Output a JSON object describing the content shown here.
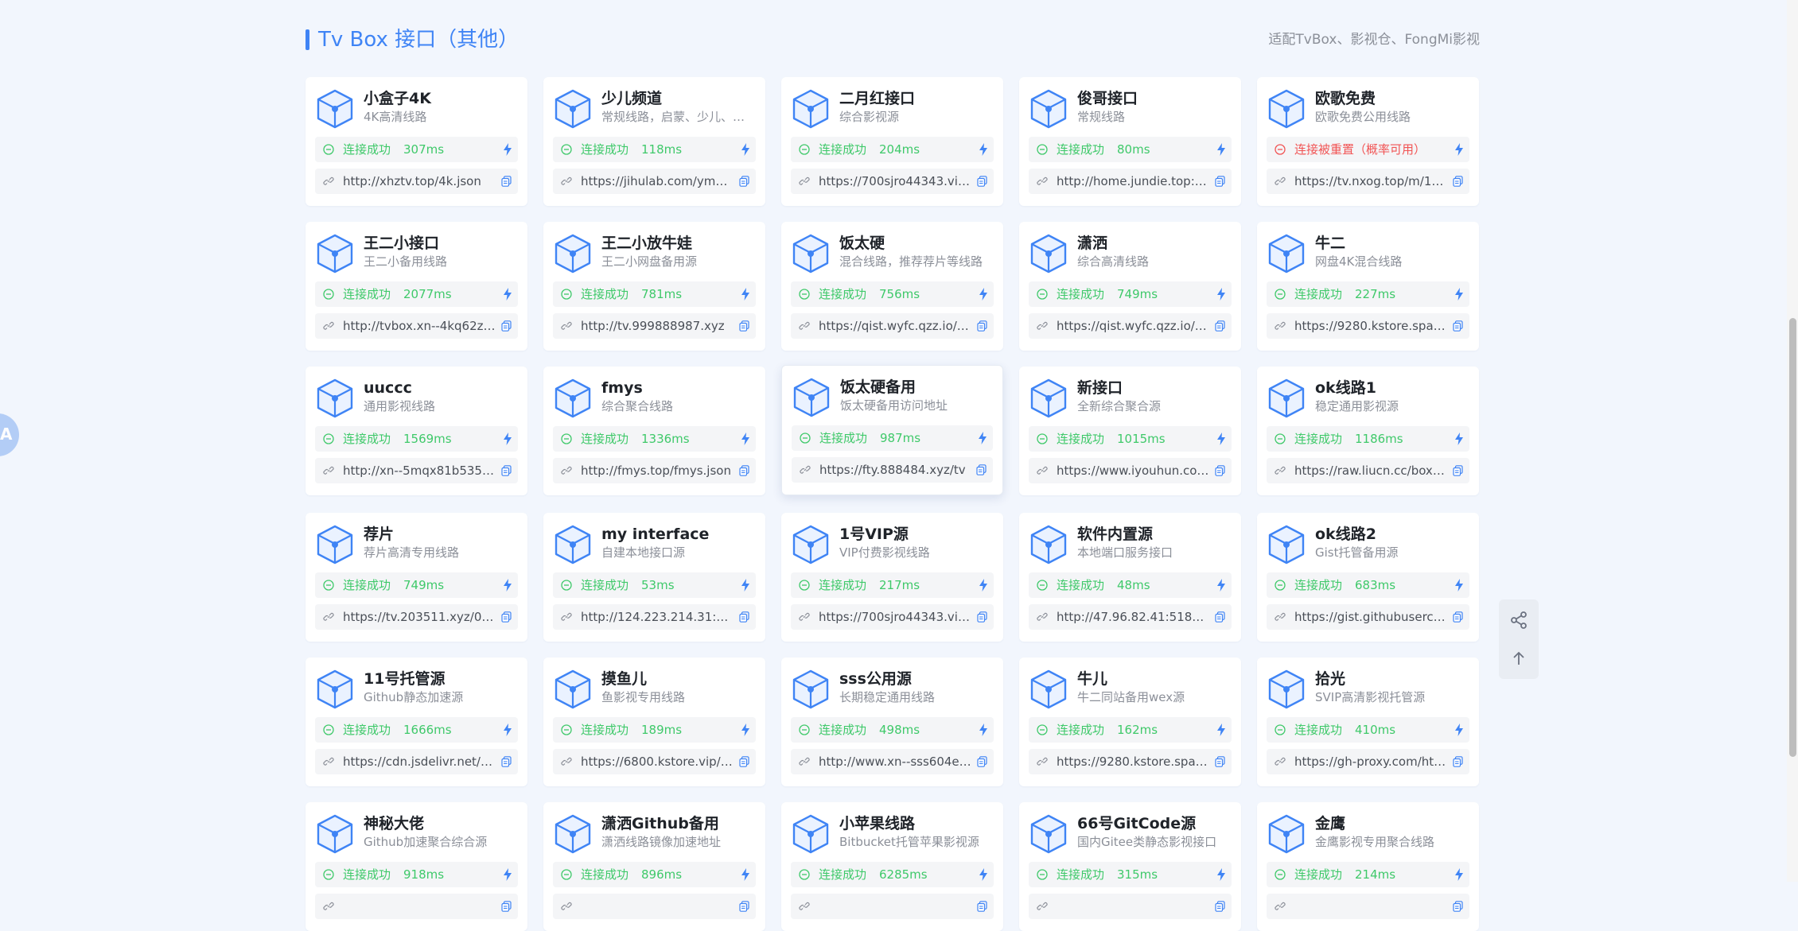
{
  "section": {
    "title": "Tv Box 接口（其他）",
    "subtitle": "适配TvBox、影视仓、FongMi影视"
  },
  "icons": {
    "logo": "cube-icon",
    "status": "signal-icon",
    "speed": "bolt-icon",
    "link": "link-icon",
    "copy": "copy-icon",
    "share": "share-icon",
    "top": "arrow-up-icon",
    "translate": "translate-icon"
  },
  "colors": {
    "accent": "#3f84f5",
    "success": "#3fc96a",
    "error": "#f15454"
  },
  "translate_label": "A",
  "cards": [
    {
      "name": "小盒子4K",
      "desc": "4K高清线路",
      "status": "连接成功",
      "latency": "307ms",
      "ok": true,
      "url": "http://xhztv.top/4k.json"
    },
    {
      "name": "少儿频道",
      "desc": "常规线路，启蒙、少儿、…",
      "status": "连接成功",
      "latency": "118ms",
      "ok": true,
      "url": "https://jihulab.com/ymz1…"
    },
    {
      "name": "二月红接口",
      "desc": "综合影视源",
      "status": "连接成功",
      "latency": "204ms",
      "ok": true,
      "url": "https://700sjro44343.vic…"
    },
    {
      "name": "俊哥接口",
      "desc": "常规线路",
      "status": "连接成功",
      "latency": "80ms",
      "ok": true,
      "url": "http://home.jundie.top:8…"
    },
    {
      "name": "欧歌免费",
      "desc": "欧歌免费公用线路",
      "status": "连接被重置（概率可用）",
      "latency": "",
      "ok": false,
      "url": "https://tv.nxog.top/m/11…"
    },
    {
      "name": "王二小接口",
      "desc": "王二小备用线路",
      "status": "连接成功",
      "latency": "2077ms",
      "ok": true,
      "url": "http://tvbox.xn--4kq62z…"
    },
    {
      "name": "王二小放牛娃",
      "desc": "王二小网盘备用源",
      "status": "连接成功",
      "latency": "781ms",
      "ok": true,
      "url": "http://tv.999888987.xyz"
    },
    {
      "name": "饭太硬",
      "desc": "混合线路，推荐荐片等线路",
      "status": "连接成功",
      "latency": "756ms",
      "ok": true,
      "url": "https://qist.wyfc.qzz.io/ft…"
    },
    {
      "name": "潇洒",
      "desc": "综合高清线路",
      "status": "连接成功",
      "latency": "749ms",
      "ok": true,
      "url": "https://qist.wyfc.qzz.io/x…"
    },
    {
      "name": "牛二",
      "desc": "网盘4K混合线路",
      "status": "连接成功",
      "latency": "227ms",
      "ok": true,
      "url": "https://9280.kstore.spac…"
    },
    {
      "name": "uuccc",
      "desc": "通用影视线路",
      "status": "连接成功",
      "latency": "1569ms",
      "ok": true,
      "url": "http://xn--5mqx81b535…"
    },
    {
      "name": "fmys",
      "desc": "综合聚合线路",
      "status": "连接成功",
      "latency": "1336ms",
      "ok": true,
      "url": "http://fmys.top/fmys.json"
    },
    {
      "name": "饭太硬备用",
      "desc": "饭太硬备用访问地址",
      "status": "连接成功",
      "latency": "987ms",
      "ok": true,
      "url": "https://fty.888484.xyz/tv",
      "hovered": true
    },
    {
      "name": "新接口",
      "desc": "全新综合聚合源",
      "status": "连接成功",
      "latency": "1015ms",
      "ok": true,
      "url": "https://www.iyouhun.co…"
    },
    {
      "name": "ok线路1",
      "desc": "稳定通用影视源",
      "status": "连接成功",
      "latency": "1186ms",
      "ok": true,
      "url": "https://raw.liucn.cc/box/…"
    },
    {
      "name": "荐片",
      "desc": "荐片高清专用线路",
      "status": "连接成功",
      "latency": "749ms",
      "ok": true,
      "url": "https://tv.203511.xyz/08…"
    },
    {
      "name": "my interface",
      "desc": "自建本地接口源",
      "status": "连接成功",
      "latency": "53ms",
      "ok": true,
      "url": "http://124.223.214.31:8/…"
    },
    {
      "name": "1号VIP源",
      "desc": "VIP付费影视线路",
      "status": "连接成功",
      "latency": "217ms",
      "ok": true,
      "url": "https://700sjro44343.vic…"
    },
    {
      "name": "软件内置源",
      "desc": "本地端口服务接口",
      "status": "连接成功",
      "latency": "48ms",
      "ok": true,
      "url": "http://47.96.82.41:5188/…"
    },
    {
      "name": "ok线路2",
      "desc": "Gist托管备用源",
      "status": "连接成功",
      "latency": "683ms",
      "ok": true,
      "url": "https://gist.githubuserco…"
    },
    {
      "name": "11号托管源",
      "desc": "Github静态加速源",
      "status": "连接成功",
      "latency": "1666ms",
      "ok": true,
      "url": "https://cdn.jsdelivr.net/g…"
    },
    {
      "name": "摸鱼儿",
      "desc": "鱼影视专用线路",
      "status": "连接成功",
      "latency": "189ms",
      "ok": true,
      "url": "https://6800.kstore.vip/fi…"
    },
    {
      "name": "sss公用源",
      "desc": "长期稳定通用线路",
      "status": "连接成功",
      "latency": "498ms",
      "ok": true,
      "url": "http://www.xn--sss604e…"
    },
    {
      "name": "牛儿",
      "desc": "牛二同站备用wex源",
      "status": "连接成功",
      "latency": "162ms",
      "ok": true,
      "url": "https://9280.kstore.spac…"
    },
    {
      "name": "拾光",
      "desc": "SVIP高清影视托管源",
      "status": "连接成功",
      "latency": "410ms",
      "ok": true,
      "url": "https://gh-proxy.com/htt…"
    },
    {
      "name": "神秘大佬",
      "desc": "Github加速聚合综合源",
      "status": "连接成功",
      "latency": "918ms",
      "ok": true,
      "url": ""
    },
    {
      "name": "潇洒Github备用",
      "desc": "潇洒线路镜像加速地址",
      "status": "连接成功",
      "latency": "896ms",
      "ok": true,
      "url": ""
    },
    {
      "name": "小苹果线路",
      "desc": "Bitbucket托管苹果影视源",
      "status": "连接成功",
      "latency": "6285ms",
      "ok": true,
      "url": ""
    },
    {
      "name": "66号GitCode源",
      "desc": "国内Gitee类静态影视接口",
      "status": "连接成功",
      "latency": "315ms",
      "ok": true,
      "url": ""
    },
    {
      "name": "金鹰",
      "desc": "金鹰影视专用聚合线路",
      "status": "连接成功",
      "latency": "214ms",
      "ok": true,
      "url": ""
    }
  ]
}
